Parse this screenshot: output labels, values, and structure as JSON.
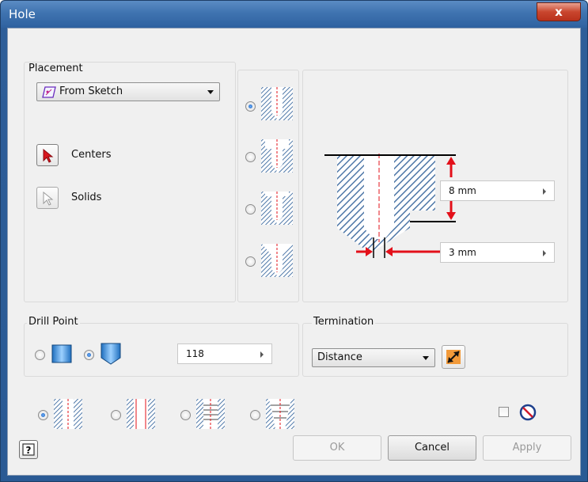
{
  "window": {
    "title": "Hole",
    "close_label": "x"
  },
  "placement": {
    "group_label": "Placement",
    "mode_value": "From Sketch",
    "centers_label": "Centers",
    "solids_label": "Solids"
  },
  "hole_types": [
    {
      "name": "simple",
      "selected": true
    },
    {
      "name": "counterbore",
      "selected": false
    },
    {
      "name": "spotface",
      "selected": false
    },
    {
      "name": "countersink",
      "selected": false
    }
  ],
  "preview": {
    "depth_value": "8 mm",
    "diameter_value": "3 mm"
  },
  "drill_point": {
    "group_label": "Drill Point",
    "flat_selected": false,
    "angle_selected": true,
    "angle_value": "118"
  },
  "termination": {
    "group_label": "Termination",
    "value": "Distance"
  },
  "thread_types": [
    {
      "name": "simple-hole",
      "selected": true
    },
    {
      "name": "clearance-hole",
      "selected": false
    },
    {
      "name": "tapped-hole",
      "selected": false
    },
    {
      "name": "taper-tapped-hole",
      "selected": false
    }
  ],
  "buttons": {
    "ok": "OK",
    "cancel": "Cancel",
    "apply": "Apply"
  },
  "colors": {
    "accent_red": "#e3101a",
    "hatch_blue": "#4f78a8"
  }
}
